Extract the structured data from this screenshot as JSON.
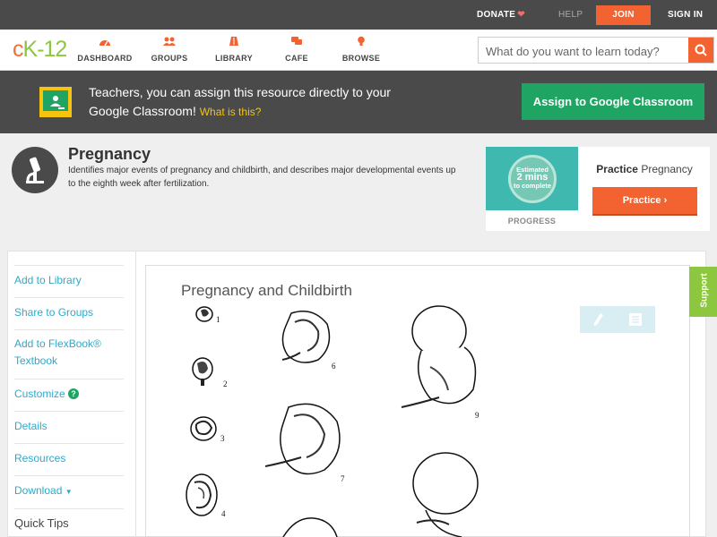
{
  "topbar": {
    "donate": "DONATE",
    "help": "HELP",
    "join": "JOIN",
    "signin": "SIGN IN"
  },
  "nav": {
    "logo": {
      "part1": "c",
      "part2": "K",
      "part3": "-12"
    },
    "items": [
      {
        "label": "DASHBOARD",
        "icon": "dashboard-icon"
      },
      {
        "label": "GROUPS",
        "icon": "groups-icon"
      },
      {
        "label": "LIBRARY",
        "icon": "library-icon"
      },
      {
        "label": "CAFE",
        "icon": "cafe-icon"
      },
      {
        "label": "BROWSE",
        "icon": "browse-icon"
      }
    ],
    "search_placeholder": "What do you want to learn today?"
  },
  "banner": {
    "text": "Teachers, you can assign this resource directly to your Google Classroom!",
    "what_is_this": "What is this?",
    "assign_button": "Assign to Google Classroom"
  },
  "concept": {
    "title": "Pregnancy",
    "description": "Identifies major events of pregnancy and childbirth, and describes major developmental events up to the eighth week after fertilization."
  },
  "practice": {
    "estimated_line1": "Estimated",
    "estimated_line2": "2 mins",
    "estimated_line3": "to complete",
    "progress_label": "PROGRESS",
    "heading_bold": "Practice",
    "heading_rest": "Pregnancy",
    "button": "Practice"
  },
  "sidebar": {
    "items": [
      {
        "label": "Add to Library"
      },
      {
        "label": "Share to Groups"
      },
      {
        "label": "Add to FlexBook®"
      },
      {
        "label": "Textbook"
      },
      {
        "label": "Customize"
      },
      {
        "label": "Details"
      },
      {
        "label": "Resources"
      },
      {
        "label": "Download"
      }
    ],
    "quick_tips": "Quick Tips"
  },
  "figure": {
    "title": "Pregnancy and Childbirth",
    "numbers": [
      "1",
      "2",
      "3",
      "4",
      "6",
      "7",
      "9"
    ]
  },
  "support": "Support",
  "colors": {
    "accent_orange": "#f26331",
    "brand_green": "#8dc63f",
    "classroom_green": "#1fa463",
    "link_blue": "#2fa9c9",
    "dark_bar": "#4a4a4a"
  }
}
